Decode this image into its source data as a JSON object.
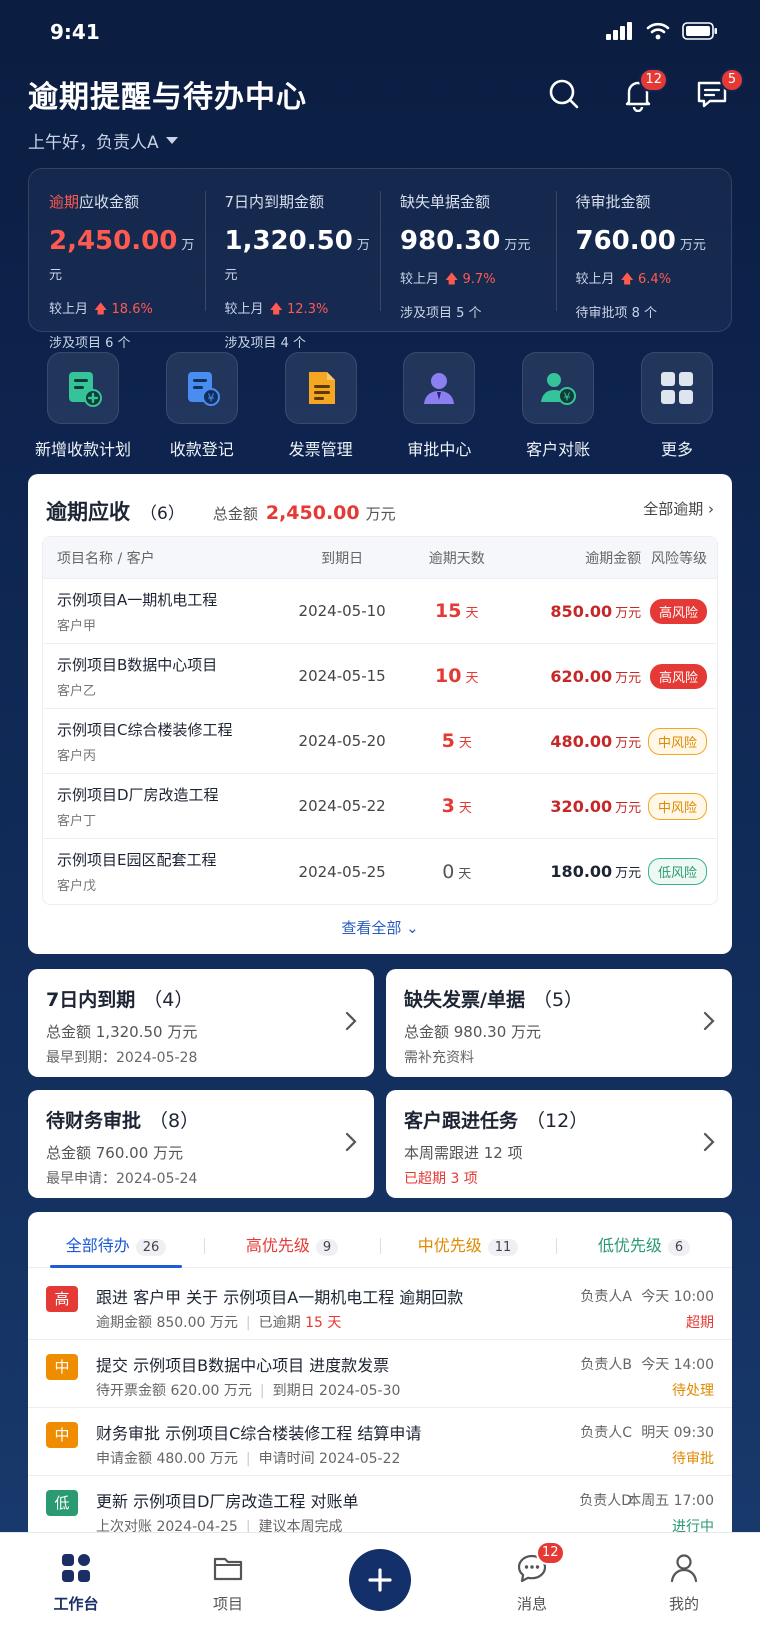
{
  "status": {
    "time": "9:41"
  },
  "header": {
    "title": "逾期提醒与待办中心",
    "greeting": "上午好，负责人A",
    "notif_badge": "12",
    "msg_badge": "5"
  },
  "kpis": [
    {
      "label_hl": "逾期",
      "label": "应收金额",
      "value": "2,450.00",
      "unit": "万元",
      "cmp_label": "较上月",
      "cmp_value": "18.6%",
      "sub": "涉及项目  6 个"
    },
    {
      "label_hl": "",
      "label": "7日内到期金额",
      "value": "1,320.50",
      "unit": "万元",
      "cmp_label": "较上月",
      "cmp_value": "12.3%",
      "sub": "涉及项目  4 个"
    },
    {
      "label_hl": "",
      "label": "缺失单据金额",
      "value": "980.30",
      "unit": "万元",
      "cmp_label": "较上月",
      "cmp_value": "9.7%",
      "sub": "涉及项目  5 个"
    },
    {
      "label_hl": "",
      "label": "待审批金额",
      "value": "760.00",
      "unit": "万元",
      "cmp_label": "较上月",
      "cmp_value": "6.4%",
      "sub": "待审批项  8 个"
    }
  ],
  "quick": [
    {
      "label": "新增收款计划",
      "icon": "plan-add-icon",
      "color": "#35c39a"
    },
    {
      "label": "收款登记",
      "icon": "receipt-yuan-icon",
      "color": "#4a8df0"
    },
    {
      "label": "发票管理",
      "icon": "invoice-icon",
      "color": "#f5a623"
    },
    {
      "label": "审批中心",
      "icon": "approver-icon",
      "color": "#8b7ff2"
    },
    {
      "label": "客户对账",
      "icon": "customer-yuan-icon",
      "color": "#35c39a"
    },
    {
      "label": "更多",
      "icon": "grid-more-icon",
      "color": "#dfe5ef"
    }
  ],
  "overdue": {
    "title": "逾期应收",
    "count": "（6）",
    "total_label": "总金额",
    "total": "2,450.00",
    "total_unit": "万元",
    "all_link": "全部逾期",
    "columns": [
      "项目名称 / 客户",
      "到期日",
      "逾期天数",
      "逾期金额",
      "风险等级"
    ],
    "rows": [
      {
        "name": "示例项目A一期机电工程",
        "customer": "客户甲",
        "date": "2024-05-10",
        "days": "15",
        "days_unit": "天",
        "amount": "850.00",
        "amount_unit": "万元",
        "risk": "高风险",
        "risk_level": "high"
      },
      {
        "name": "示例项目B数据中心项目",
        "customer": "客户乙",
        "date": "2024-05-15",
        "days": "10",
        "days_unit": "天",
        "amount": "620.00",
        "amount_unit": "万元",
        "risk": "高风险",
        "risk_level": "high"
      },
      {
        "name": "示例项目C综合楼装修工程",
        "customer": "客户丙",
        "date": "2024-05-20",
        "days": "5",
        "days_unit": "天",
        "amount": "480.00",
        "amount_unit": "万元",
        "risk": "中风险",
        "risk_level": "mid"
      },
      {
        "name": "示例项目D厂房改造工程",
        "customer": "客户丁",
        "date": "2024-05-22",
        "days": "3",
        "days_unit": "天",
        "amount": "320.00",
        "amount_unit": "万元",
        "risk": "中风险",
        "risk_level": "mid"
      },
      {
        "name": "示例项目E园区配套工程",
        "customer": "客户戊",
        "date": "2024-05-25",
        "days": "0",
        "days_unit": "天",
        "amount": "180.00",
        "amount_unit": "万元",
        "risk": "低风险",
        "risk_level": "low"
      }
    ],
    "view_all": "查看全部"
  },
  "mini_cards": [
    {
      "title": "7日内到期",
      "count": "（4）",
      "line1": "总金额 1,320.50 万元",
      "line2": "最早到期：2024-05-28"
    },
    {
      "title": "缺失发票/单据",
      "count": "（5）",
      "line1": "总金额 980.30 万元",
      "line2": "需补充资料"
    },
    {
      "title": "待财务审批",
      "count": "（8）",
      "line1": "总金额 760.00 万元",
      "line2": "最早申请：2024-05-24"
    },
    {
      "title": "客户跟进任务",
      "count": "（12）",
      "line1": "本周需跟进 12 项",
      "line2": "已超期 3 项"
    }
  ],
  "todo": {
    "tabs": [
      {
        "label": "全部待办",
        "count": "26"
      },
      {
        "label": "高优先级",
        "count": "9"
      },
      {
        "label": "中优先级",
        "count": "11"
      },
      {
        "label": "低优先级",
        "count": "6"
      }
    ],
    "items": [
      {
        "badge": "高",
        "title": "跟进  客户甲  关于  示例项目A一期机电工程  逾期回款",
        "sub1": "逾期金额  850.00 万元",
        "sub2a": "已逾期 ",
        "sub2b": "15 天",
        "owner": "负责人A",
        "time": "今天 10:00",
        "status": "超期"
      },
      {
        "badge": "中",
        "title": "提交  示例项目B数据中心项目  进度款发票",
        "sub1": "待开票金额  620.00 万元",
        "sub2a": "到期日  2024-05-30",
        "sub2b": "",
        "owner": "负责人B",
        "time": "今天 14:00",
        "status": "待处理"
      },
      {
        "badge": "中",
        "title": "财务审批  示例项目C综合楼装修工程  结算申请",
        "sub1": "申请金额  480.00 万元",
        "sub2a": "申请时间  2024-05-22",
        "sub2b": "",
        "owner": "负责人C",
        "time": "明天 09:30",
        "status": "待审批"
      },
      {
        "badge": "低",
        "title": "更新  示例项目D厂房改造工程  对账单",
        "sub1": "上次对账  2024-04-25",
        "sub2a": "建议本周完成",
        "sub2b": "",
        "owner": "负责人D",
        "time": "本周五 17:00",
        "status": "进行中"
      }
    ]
  },
  "nav": [
    {
      "label": "工作台",
      "icon": "dashboard-icon"
    },
    {
      "label": "项目",
      "icon": "folder-icon"
    },
    {
      "label": "",
      "icon": "plus-icon"
    },
    {
      "label": "消息",
      "icon": "chat-icon",
      "badge": "12"
    },
    {
      "label": "我的",
      "icon": "user-icon"
    }
  ],
  "colors": {
    "accent": "#1e5bd8",
    "danger": "#e53935",
    "warn": "#f08c00",
    "ok": "#2a9a73",
    "bg": "#0e2550"
  }
}
